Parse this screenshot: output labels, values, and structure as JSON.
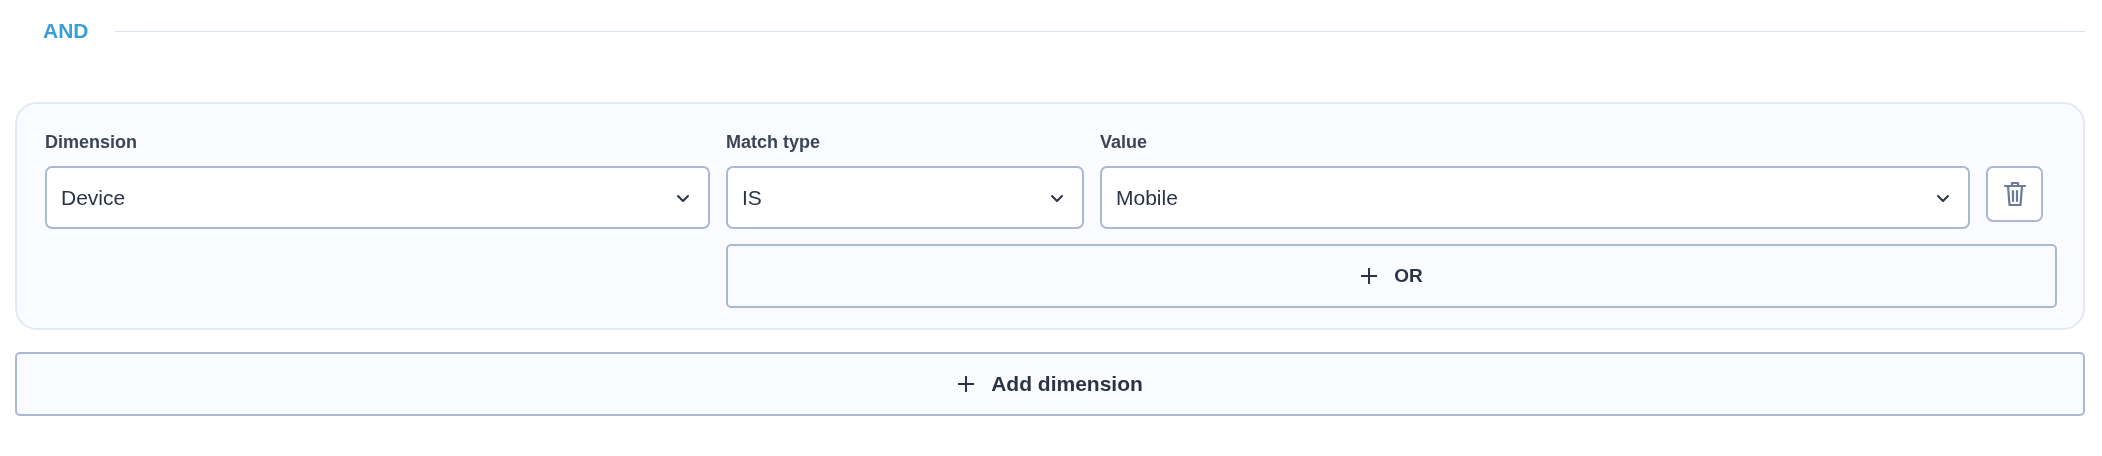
{
  "group_label": "AND",
  "condition": {
    "fields": [
      {
        "label": "Dimension",
        "value": "Device"
      },
      {
        "label": "Match type",
        "value": "IS"
      },
      {
        "label": "Value",
        "value": "Mobile"
      }
    ],
    "or_button": "OR"
  },
  "add_button": "Add dimension"
}
